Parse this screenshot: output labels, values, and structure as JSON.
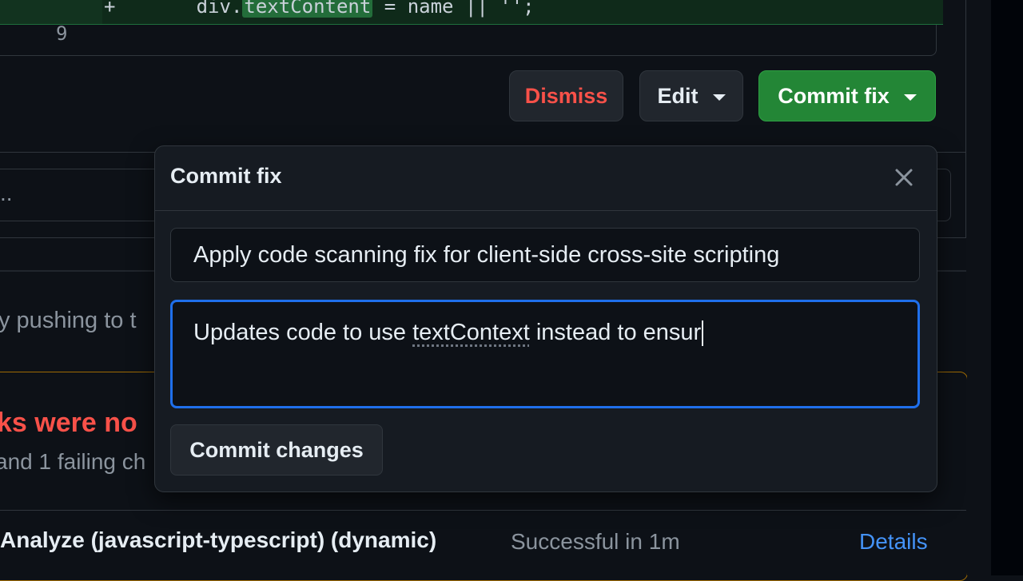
{
  "diff": {
    "code_prefix": "+       div.",
    "code_highlight": "textContent",
    "code_suffix": " = name || '';",
    "line_number": "9"
  },
  "actions": {
    "dismiss_label": "Dismiss",
    "edit_label": "Edit",
    "commit_fix_label": "Commit fix"
  },
  "background": {
    "truncated_input": "..",
    "push_text": "y pushing to t",
    "warning_title": "ks were no",
    "warning_sub": "and 1 failing ch",
    "check": {
      "name": "Analyze (javascript-typescript) (dynamic)",
      "status": "Successful in 1m",
      "details_label": "Details"
    }
  },
  "modal": {
    "title": "Commit fix",
    "commit_title_value": "Apply code scanning fix for client-side cross-site scripting",
    "description_before": "Updates code to use ",
    "description_squiggle": "textContext",
    "description_after": " instead to ensur",
    "commit_button_label": "Commit changes"
  },
  "colors": {
    "danger": "#f85149",
    "primary": "#238636",
    "focus": "#1f6feb",
    "link": "#4493f8"
  }
}
